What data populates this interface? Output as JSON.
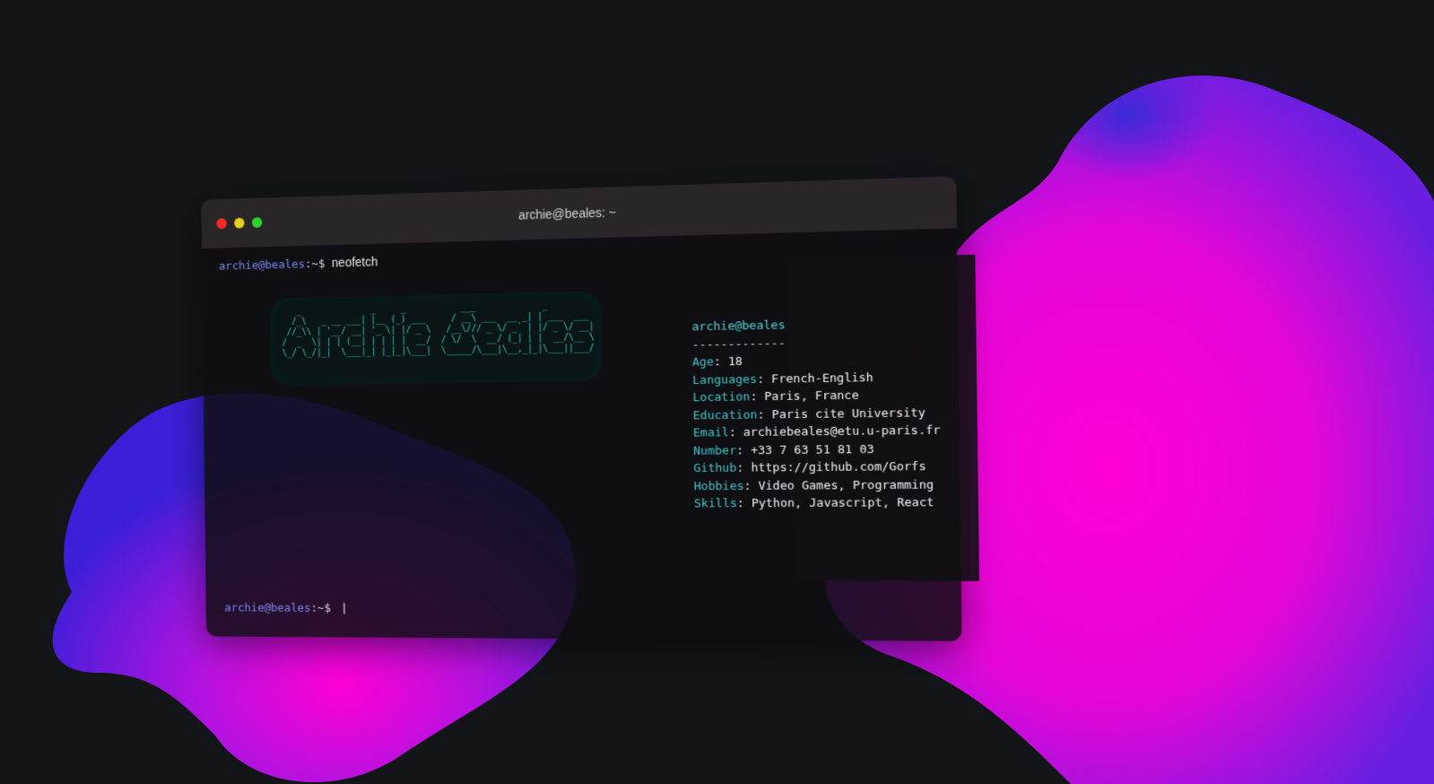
{
  "window": {
    "title": "archie@beales: ~",
    "colors": {
      "close": "#ff2b2b",
      "minimize": "#e6d21b",
      "maximize": "#2bd42b"
    }
  },
  "terminal": {
    "prompt_user": "archie@beales",
    "prompt_suffix": ":~$",
    "command": "neofetch",
    "bottom_prompt_user": "archie@beales",
    "bottom_prompt_suffix": ":~$",
    "cursor": "|"
  },
  "ascii_art": "    _              _     _           ___             _              \n   /_\\   _ __ ___| |__ (_) ___     / __\\ ___  __ _| | ___  ___    \n  //_\\\\ | '__/ __| '_ \\| |/ _ \\   /__\\/// _ \\/ _` | |/ _ \\/ __|   \n /  _  \\| | | (__| | | | |  __/  / \\/  \\  __/ (_| | |  __/\\__ \\   \n \\_/ \\_/|_|  \\___|_| |_|_|\\___|  \\_____/\\___|\\__,_|_|\\___||___/   ",
  "info": {
    "user": "archie@beales",
    "separator": "-------------",
    "fields": [
      {
        "key": "Age",
        "value": "18"
      },
      {
        "key": "Languages",
        "value": "French-English"
      },
      {
        "key": "Location",
        "value": "Paris, France"
      },
      {
        "key": "Education",
        "value": "Paris cite University"
      },
      {
        "key": "Email",
        "value": "archiebeales@etu.u-paris.fr"
      },
      {
        "key": "Number",
        "value": "+33 7 63 51 81 03"
      },
      {
        "key": "Github",
        "value": "https://github.com/Gorfs"
      },
      {
        "key": "Hobbies",
        "value": "Video Games, Programming"
      },
      {
        "key": "Skills",
        "value": "Python, Javascript, React"
      }
    ]
  },
  "background": {
    "blob_colors": {
      "pink": "#ff00d4",
      "purple": "#a010e0",
      "blue": "#3a1fd8"
    },
    "page": "#131417"
  }
}
